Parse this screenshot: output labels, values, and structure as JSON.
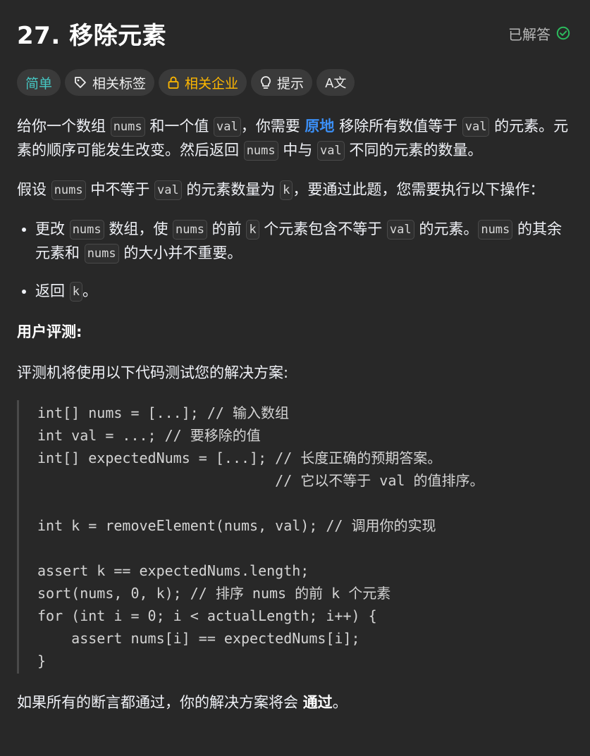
{
  "problem": {
    "title": "27. 移除元素",
    "status": "已解答"
  },
  "tags": {
    "difficulty": "简单",
    "related_tags": "相关标签",
    "company": "相关企业",
    "hint": "提示",
    "translate": "A文"
  },
  "description": {
    "p1": {
      "t1": "给你一个数组 ",
      "c1": "nums",
      "t2": " 和一个值 ",
      "c2": "val",
      "t3": "，你需要 ",
      "hl": "原地",
      "t4": " 移除所有数值等于 ",
      "c3": "val",
      "t5": " 的元素。元素的顺序可能发生改变。然后返回 ",
      "c4": "nums",
      "t6": " 中与 ",
      "c5": "val",
      "t7": " 不同的元素的数量。"
    },
    "p2": {
      "t1": "假设 ",
      "c1": "nums",
      "t2": " 中不等于 ",
      "c2": "val",
      "t3": " 的元素数量为 ",
      "c3": "k",
      "t4": "，要通过此题，您需要执行以下操作："
    },
    "bullet1": {
      "t1": "更改 ",
      "c1": "nums",
      "t2": " 数组，使 ",
      "c2": "nums",
      "t3": " 的前 ",
      "c3": "k",
      "t4": " 个元素包含不等于 ",
      "c4": "val",
      "t5": " 的元素。",
      "c5": "nums",
      "t6": " 的其余元素和 ",
      "c6": "nums",
      "t7": " 的大小并不重要。"
    },
    "bullet2": {
      "t1": "返回 ",
      "c1": "k",
      "t2": "。"
    },
    "judge_heading": "用户评测:",
    "judge_intro": "评测机将使用以下代码测试您的解决方案:",
    "code_lines": [
      "int[] nums = [...]; // 输入数组",
      "int val = ...; // 要移除的值",
      "int[] expectedNums = [...]; // 长度正确的预期答案。",
      "                            // 它以不等于 val 的值排序。",
      "",
      "int k = removeElement(nums, val); // 调用你的实现",
      "",
      "assert k == expectedNums.length;",
      "sort(nums, 0, k); // 排序 nums 的前 k 个元素",
      "for (int i = 0; i < actualLength; i++) {",
      "    assert nums[i] == expectedNums[i];",
      "}"
    ],
    "conclusion": {
      "t1": "如果所有的断言都通过，你的解决方案将会 ",
      "b1": "通过",
      "t2": "。"
    }
  },
  "colors": {
    "background": "#282828",
    "easy": "#46c6c2",
    "company": "#ffb800",
    "highlight": "#3b8ff6",
    "solved_check": "#2cbb5d"
  }
}
